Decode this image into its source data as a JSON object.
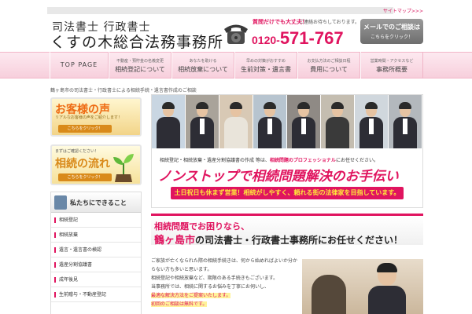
{
  "top": {
    "link": "サイトマップ>>>"
  },
  "brand": {
    "line1": "司法書士 行政書士",
    "line2": "くすの木総合法務事務所"
  },
  "phone": {
    "tag": "質問だけでも大丈夫！",
    "tag2": "ご連絡お待ちしております。",
    "free_label": "フリーダイヤル",
    "prefix": "0120-",
    "number": "571-767"
  },
  "mail_button": {
    "line1": "メールでのご相談は",
    "line2": "こちらをクリック！"
  },
  "nav": {
    "top": "TOP PAGE",
    "items": [
      {
        "sub": "不動産・預貯金の名義変更",
        "main": "相続登記について"
      },
      {
        "sub": "あなたを助ける",
        "main": "相続放棄について"
      },
      {
        "sub": "早めの対策がおすすめ",
        "main": "生前対策・遺言書"
      },
      {
        "sub": "お支払方法のご相談日程",
        "main": "費用について"
      },
      {
        "sub": "営業時間・アクセスなど",
        "main": "事務所概要"
      }
    ]
  },
  "tagline": "鶴ヶ島市の司法書士・行政書士による相続手続・遺言書作成のご相談",
  "sidebar": {
    "voice": {
      "title": "お客様の声",
      "sub": "リアルなお客様の声をご紹介します！",
      "button": "こちらをクリック！"
    },
    "flow": {
      "top": "まずはご確認ください！",
      "title": "相続の流れ",
      "button": "こちらをクリック！"
    },
    "panel_title": "私たちにできること",
    "items": [
      "相続登記",
      "相続放棄",
      "遺言・遺言書の検認",
      "遺産分割協議書",
      "成年後見",
      "生前贈与・不動産登記"
    ]
  },
  "hero": {
    "lead_pre": "相続登記・相続放棄・遺産分割協議書の作成 等は、",
    "lead_pink": "相続問題のプロフェッショナル",
    "lead_post": "にお任せください。",
    "main": "ノンストップで相続問題解決のお手伝い",
    "bar": "土日祝日も休まず営業！相続がしやすく、頼れる街の法律家を目指しています。"
  },
  "banner2": {
    "line1": "相続問題でお困りなら、",
    "city": "鶴ヶ島市",
    "line2": "の司法書士・行政書士事務所にお任せください！"
  },
  "body": {
    "p1": "ご家族が亡くなられた際の相続手続きは、何から始めればよいか分からない方も多いと思います。",
    "p2": "相続登記や相続放棄など、期限のある手続きもございます。",
    "p3": "当事務所では、相続に関するお悩みを丁寧にお伺いし、",
    "hl1": "最適な解決方法をご提案いたします。",
    "hl2": "初回のご相談は無料です。"
  }
}
